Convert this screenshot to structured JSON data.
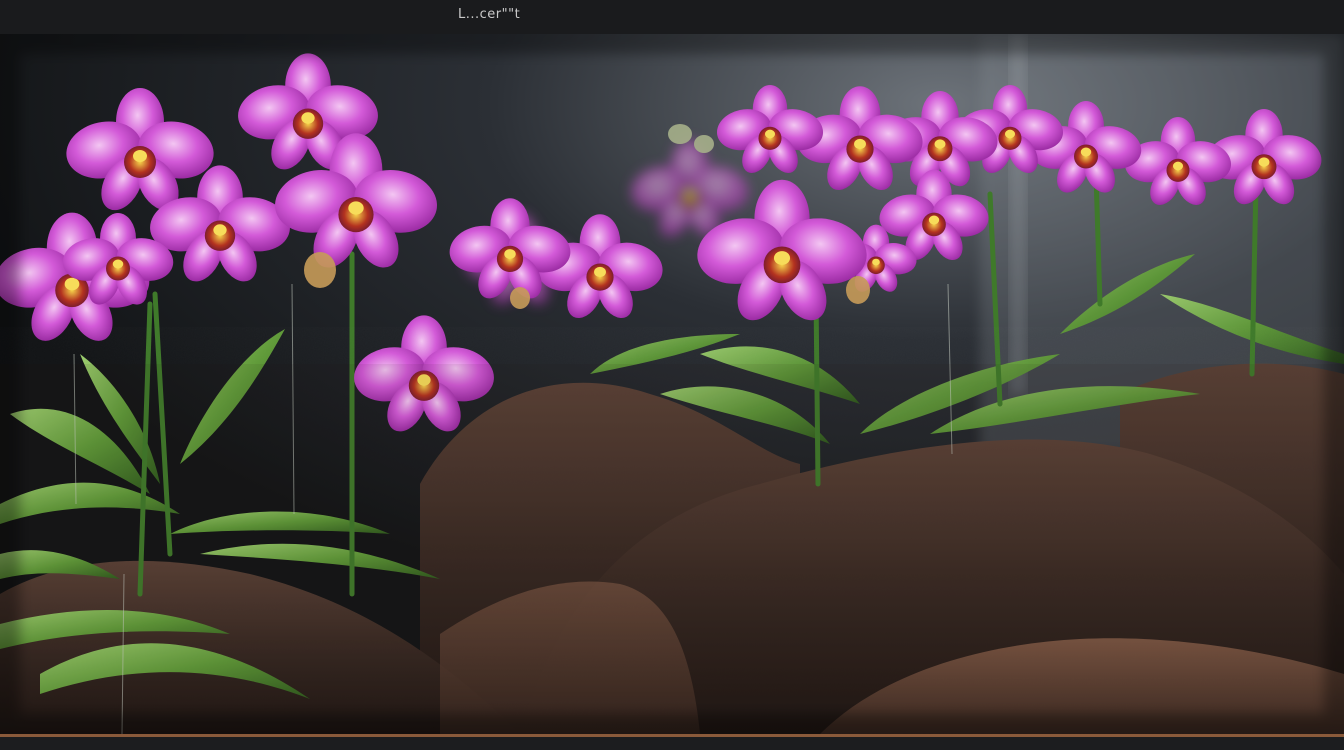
{
  "window": {
    "title": "L...cer\"\"t"
  },
  "image": {
    "subject": "orchid-photo"
  },
  "colors": {
    "background": "#111214",
    "petal": "#c43fd0",
    "petal_light": "#e79ae9",
    "leaf": "#6ba341",
    "soil": "#3b2a22",
    "bar_accent": "#8a5a3a"
  }
}
